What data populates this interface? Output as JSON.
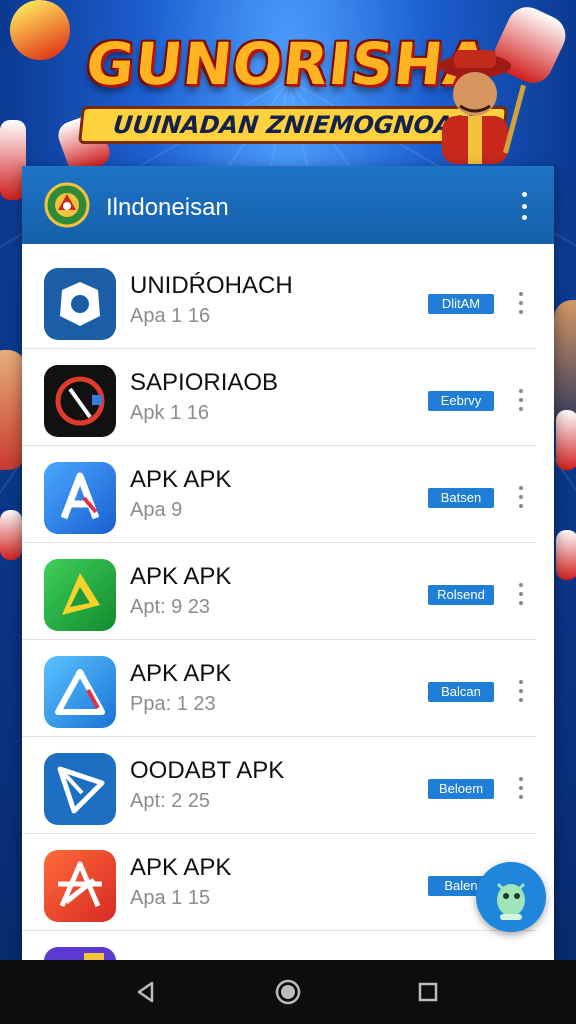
{
  "banner": {
    "title": "GUNORISHA",
    "subtitle": "UUINADAN ZNIEMOGNOAN"
  },
  "header": {
    "title": "Ilndoneisan",
    "menu_icon": "more-vert-icon"
  },
  "apps": [
    {
      "name": "UNIDŔOHACH",
      "version": "Apa 1 16",
      "action": "DlitAM",
      "icon": "camera-shutter-icon",
      "color": "#1c5fa8"
    },
    {
      "name": "SAPIORIAOB",
      "version": "Apk 1 16",
      "action": "Eebrvy",
      "icon": "red-arc-icon",
      "color": "#111111"
    },
    {
      "name": "APK APK",
      "version": "Apa 9",
      "action": "Batsen",
      "icon": "letter-a-icon",
      "color": "#2b7be0"
    },
    {
      "name": "APK APK",
      "version": "Apt: 9 23",
      "action": "Rolsend",
      "icon": "play-arrow-icon",
      "color": "#1fae3c"
    },
    {
      "name": "APK APK",
      "version": "Ppa: 1 23",
      "action": "Balcan",
      "icon": "triangle-a-icon",
      "color": "#2a8fe8"
    },
    {
      "name": "OODABT APK",
      "version": "Apt: 2 25",
      "action": "Beloem",
      "icon": "paper-plane-icon",
      "color": "#1d6fc4"
    },
    {
      "name": "APK APK",
      "version": "Apa 1 15",
      "action": "Balen",
      "icon": "star-a-icon",
      "color": "#e8462a"
    }
  ],
  "fab": {
    "icon": "robot-icon"
  },
  "navbar": {
    "back": "back-icon",
    "home": "home-icon",
    "recents": "recents-icon"
  }
}
